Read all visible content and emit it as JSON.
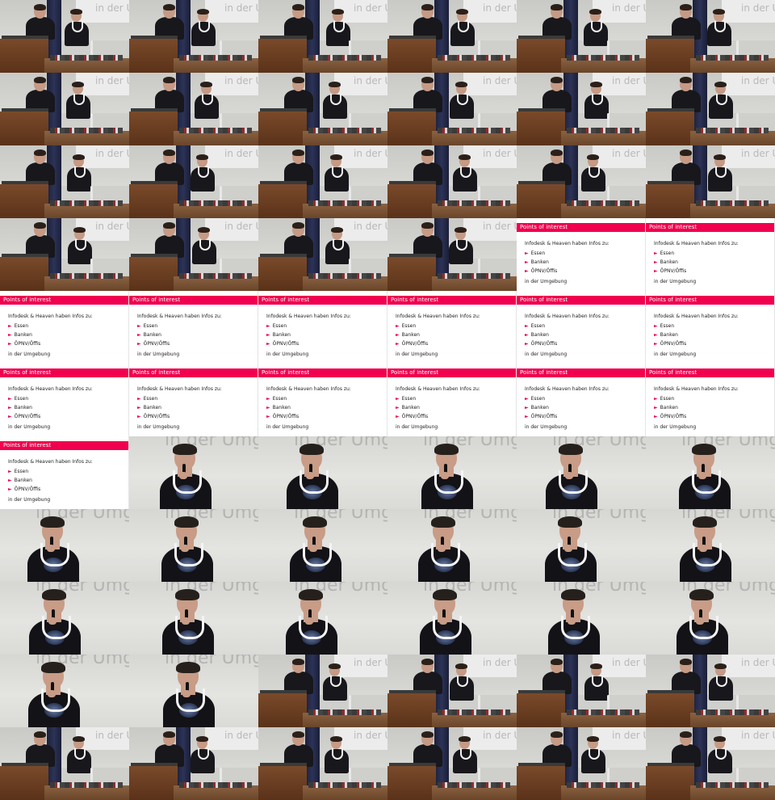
{
  "slide_watermark": "in der Umgebung",
  "slide": {
    "title": "Points of interest",
    "lead": "Infodesk & Heaven haben Infos zu:",
    "items": [
      "Essen",
      "Banken",
      "ÖPNV/Öffis"
    ],
    "footer": "in der Umgebung"
  },
  "grid": {
    "columns": 6,
    "rows": 11,
    "cells": [
      "wide",
      "wide",
      "wide",
      "wide",
      "wide",
      "wide",
      "wide",
      "wide",
      "wide",
      "wide",
      "wide",
      "wide",
      "wide",
      "wide",
      "wide",
      "wide",
      "wide",
      "wide",
      "wide",
      "wide",
      "wide",
      "wide",
      "slide",
      "slide",
      "slide",
      "slide",
      "slide",
      "slide",
      "slide",
      "slide",
      "slide",
      "slide",
      "slide",
      "slide",
      "slide",
      "slide",
      "slide",
      "close",
      "close",
      "close",
      "close",
      "close",
      "close",
      "close",
      "close",
      "close",
      "close",
      "close",
      "close",
      "close",
      "close",
      "close",
      "close",
      "close",
      "close",
      "close",
      "wide",
      "wide",
      "wide",
      "wide",
      "wide",
      "wide",
      "wide",
      "wide",
      "wide",
      "wide"
    ]
  },
  "colors": {
    "accent": "#f0004e",
    "curtain": "#2c3358",
    "lectern": "#6a4026"
  }
}
